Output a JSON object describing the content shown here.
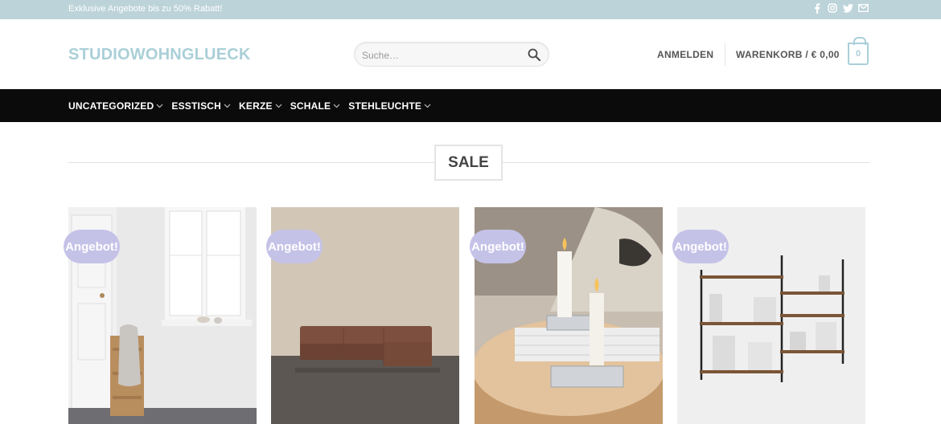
{
  "topbar": {
    "promo": "Exklusive Angebote bis zu 50% Rabatt!",
    "social_icons": [
      "facebook-icon",
      "instagram-icon",
      "twitter-icon",
      "email-icon"
    ]
  },
  "header": {
    "logo": "STUDIOWOHNGLUECK",
    "search_placeholder": "Suche…",
    "account_label": "ANMELDEN",
    "cart_label": "WARENKORB / € 0,00",
    "cart_count": "0"
  },
  "nav": {
    "items": [
      {
        "label": "UNCATEGORIZED"
      },
      {
        "label": "ESSTISCH"
      },
      {
        "label": "KERZE"
      },
      {
        "label": "SCHALE"
      },
      {
        "label": "STEHLEUCHTE"
      }
    ]
  },
  "section": {
    "title": "SALE"
  },
  "products": [
    {
      "badge": "Angebot!",
      "image": "bathroom-stool-towel-image"
    },
    {
      "badge": "Angebot!",
      "image": "brown-sofa-image"
    },
    {
      "badge": "Angebot!",
      "image": "candle-holder-table-image"
    },
    {
      "badge": "Angebot!",
      "image": "wall-shelf-system-image"
    }
  ],
  "colors": {
    "topbar": "#bcd3d9",
    "accent": "#aacfd8",
    "nav": "#0b0b0b",
    "badge": "#c5c2e8"
  }
}
